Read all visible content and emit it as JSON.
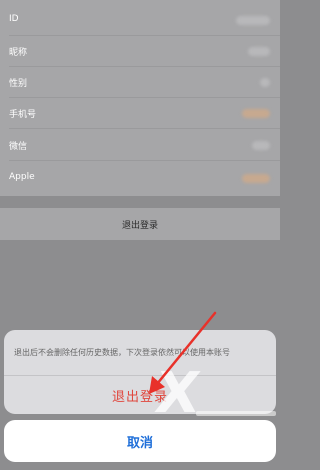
{
  "settings": {
    "rows": [
      {
        "label": "ID"
      },
      {
        "label": "昵称"
      },
      {
        "label": "性别"
      },
      {
        "label": "手机号"
      },
      {
        "label": "微信"
      },
      {
        "label": "Apple"
      }
    ],
    "logout_label": "退出登录"
  },
  "action_sheet": {
    "message": "退出后不会删除任何历史数据，下次登录依然可以使用本账号",
    "confirm_label": "退出登录",
    "cancel_label": "取消"
  },
  "colors": {
    "destructive": "#e0473e",
    "cancel_text": "#1f6fd9",
    "annotation_arrow": "#e8312a"
  }
}
